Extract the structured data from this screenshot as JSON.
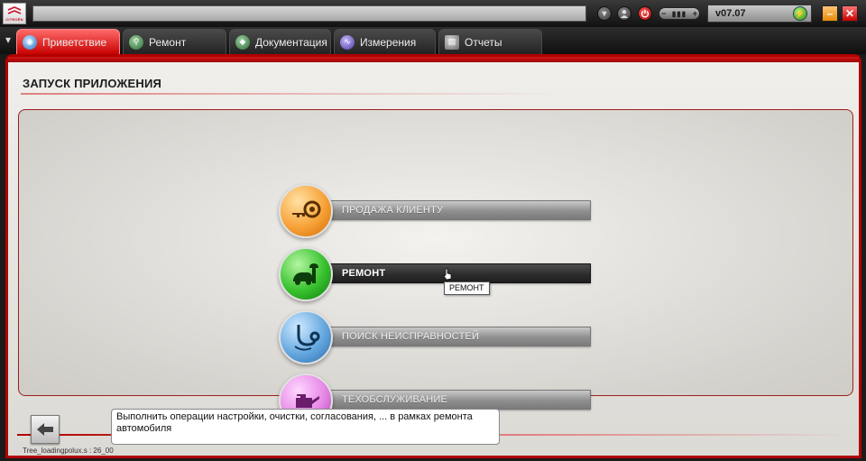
{
  "app": {
    "brand": "CITROËN",
    "version": "v07.07"
  },
  "titlebar": {
    "minimize_label": "–",
    "close_label": "✕"
  },
  "tabs": [
    {
      "label": "Приветствие",
      "active": true,
      "icon": "globe-icon"
    },
    {
      "label": "Ремонт",
      "active": false,
      "icon": "magnifier-icon"
    },
    {
      "label": "Документация",
      "active": false,
      "icon": "book-icon"
    },
    {
      "label": "Измерения",
      "active": false,
      "icon": "waveform-icon"
    },
    {
      "label": "Отчеты",
      "active": false,
      "icon": "clipboard-icon"
    }
  ],
  "main": {
    "title": "ЗАПУСК ПРИЛОЖЕНИЯ",
    "menu": [
      {
        "label": "ПРОДАЖА КЛИЕНТУ",
        "icon": "key-icon",
        "color": "#f7a238"
      },
      {
        "label": "РЕМОНТ",
        "icon": "car-wrench-icon",
        "color": "#38c22e"
      },
      {
        "label": "ПОИСК НЕИСПРАВНОСТЕЙ",
        "icon": "stethoscope-icon",
        "color": "#65a8df"
      },
      {
        "label": "ТЕХОБСЛУЖИВАНИЕ",
        "icon": "oil-can-icon",
        "color": "#e688e6"
      }
    ],
    "tooltip": "РЕМОНТ",
    "description": "Выполнить операции настройки, очистки, согласования, ... в рамках ремонта автомобиля",
    "status": "Tree_loadingpolux.s : 26_00"
  },
  "colors": {
    "accent": "#c80000",
    "panel_bg": "#e6e4df"
  }
}
